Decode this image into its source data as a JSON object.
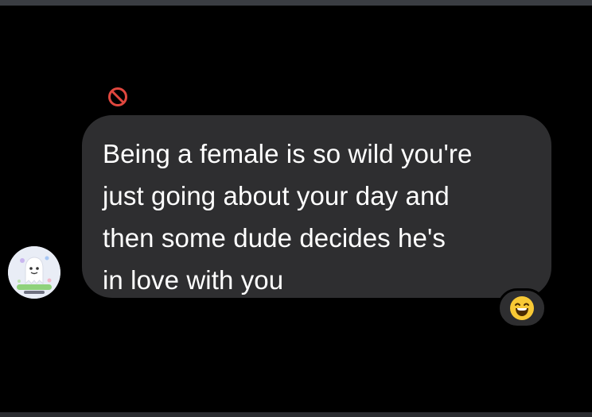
{
  "message": {
    "lines": [
      "Being a female is so wild you're",
      "just going about your day and",
      "then some dude decides he's",
      "in love with you"
    ],
    "status_icon": "prohibited-icon",
    "reaction_icon": "laughing-face-icon",
    "avatar_icon": "ghost-avatar-icon"
  },
  "colors": {
    "background": "#000000",
    "bubble": "#2e2e30",
    "text": "#ffffff",
    "status_icon": "#e0473e",
    "reaction_face": "#f8c935"
  }
}
